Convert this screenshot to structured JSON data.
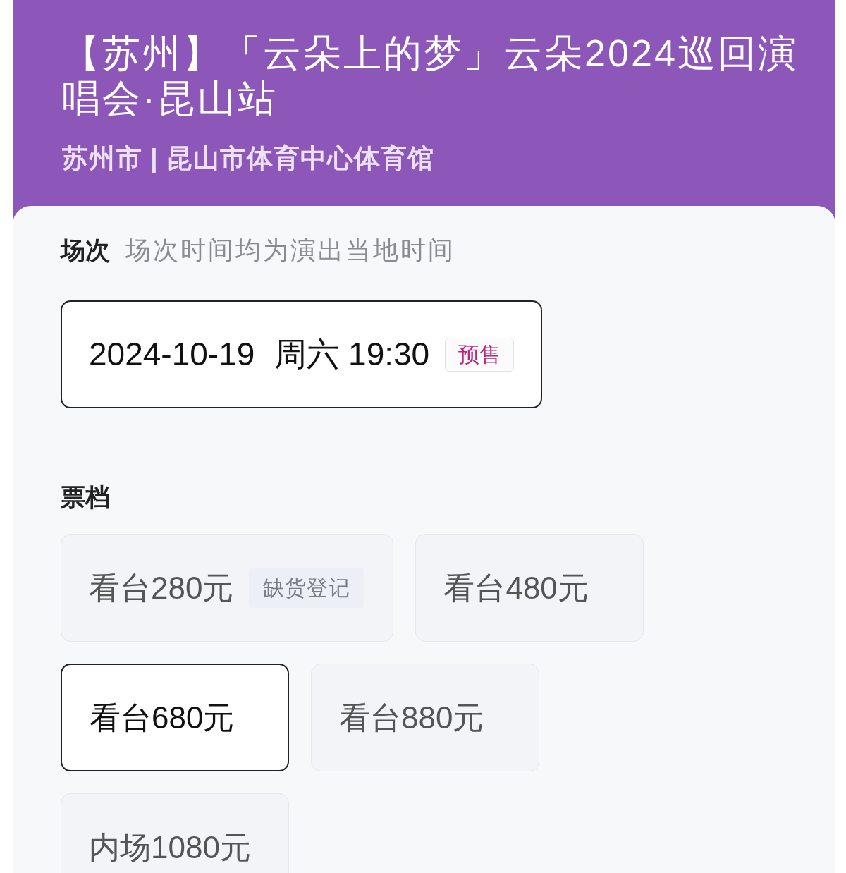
{
  "header": {
    "title": "【苏州】「云朵上的梦」云朵2024巡回演唱会·昆山站",
    "venue": "苏州市 | 昆山市体育中心体育馆"
  },
  "sessions": {
    "label": "场次",
    "hint": "场次时间均为演出当地时间",
    "items": [
      {
        "date": "2024-10-19",
        "time": "周六 19:30",
        "badge": {
          "text": "预售",
          "kind": "presale"
        },
        "selected": true
      }
    ]
  },
  "tiers": {
    "label": "票档",
    "items": [
      {
        "name": "看台280元",
        "badge": {
          "text": "缺货登记",
          "kind": "soldout"
        },
        "selected": false
      },
      {
        "name": "看台480元",
        "selected": false
      },
      {
        "name": "看台680元",
        "selected": true
      },
      {
        "name": "看台880元",
        "selected": false
      },
      {
        "name": "内场1080元",
        "selected": false
      }
    ]
  }
}
